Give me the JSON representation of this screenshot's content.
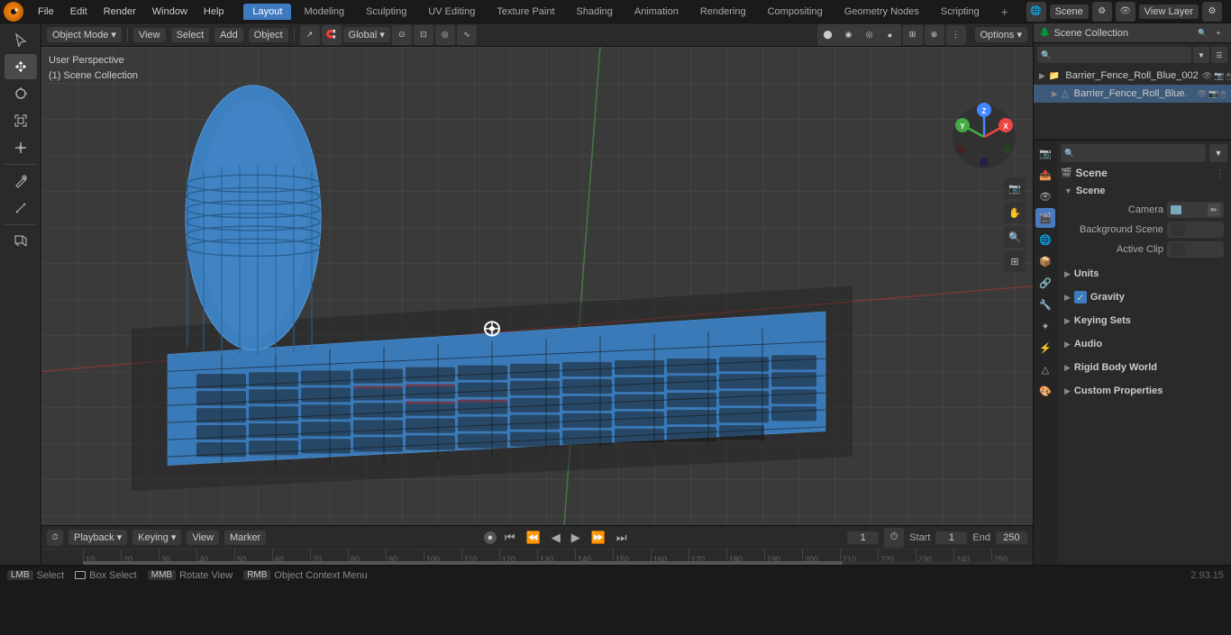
{
  "app": {
    "title": "Blender",
    "version": "2.93.15"
  },
  "top_menu": {
    "items": [
      "File",
      "Edit",
      "Render",
      "Window",
      "Help"
    ]
  },
  "workspace_tabs": {
    "items": [
      "Layout",
      "Modeling",
      "Sculpting",
      "UV Editing",
      "Texture Paint",
      "Shading",
      "Animation",
      "Rendering",
      "Compositing",
      "Geometry Nodes",
      "Scripting"
    ],
    "active": "Layout"
  },
  "viewport_header": {
    "object_mode_label": "Object Mode",
    "view_label": "View",
    "select_label": "Select",
    "add_label": "Add",
    "object_label": "Object",
    "transform": "Global",
    "options_label": "Options ▾"
  },
  "viewport_info": {
    "perspective": "User Perspective",
    "collection": "(1) Scene Collection"
  },
  "outliner": {
    "title": "Scene Collection",
    "items": [
      {
        "name": "Barrier_Fence_Roll_Blue_002",
        "type": "collection",
        "indent": 0
      },
      {
        "name": "Barrier_Fence_Roll_Blue.",
        "type": "mesh",
        "indent": 1
      }
    ]
  },
  "properties": {
    "scene_label": "Scene",
    "sections": {
      "scene": {
        "title": "Scene",
        "camera_label": "Camera",
        "camera_value": "",
        "bg_scene_label": "Background Scene",
        "active_clip_label": "Active Clip"
      },
      "units": {
        "title": "Units"
      },
      "gravity": {
        "title": "Gravity",
        "enabled": true
      },
      "keying_sets": {
        "title": "Keying Sets"
      },
      "audio": {
        "title": "Audio"
      },
      "rigid_body_world": {
        "title": "Rigid Body World"
      },
      "custom_properties": {
        "title": "Custom Properties"
      }
    }
  },
  "timeline": {
    "playback_label": "Playback",
    "keying_label": "Keying",
    "view_label": "View",
    "marker_label": "Marker",
    "current_frame": "1",
    "start_label": "Start",
    "start_value": "1",
    "end_label": "End",
    "end_value": "250",
    "record_icon": "●"
  },
  "ruler": {
    "marks": [
      "10",
      "20",
      "30",
      "40",
      "50",
      "60",
      "70",
      "80",
      "90",
      "100",
      "110",
      "120",
      "130",
      "140",
      "150",
      "160",
      "170",
      "180",
      "190",
      "200",
      "210",
      "220",
      "230",
      "240",
      "250"
    ]
  },
  "status_bar": {
    "select_label": "Select",
    "box_select_label": "Box Select",
    "rotate_view_label": "Rotate View",
    "context_menu_label": "Object Context Menu",
    "version": "2.93.15"
  },
  "prop_icons": [
    "🎬",
    "📷",
    "🌐",
    "🎭",
    "⚙",
    "🔧",
    "💡",
    "🎨",
    "🔲",
    "📊",
    "🔗",
    "⬜",
    "🟦"
  ],
  "colors": {
    "accent_blue": "#3d7abf",
    "mesh_blue": "#4d9de0",
    "background": "#3a3a3a",
    "panel": "#2a2a2a",
    "dark": "#1a1a1a"
  }
}
